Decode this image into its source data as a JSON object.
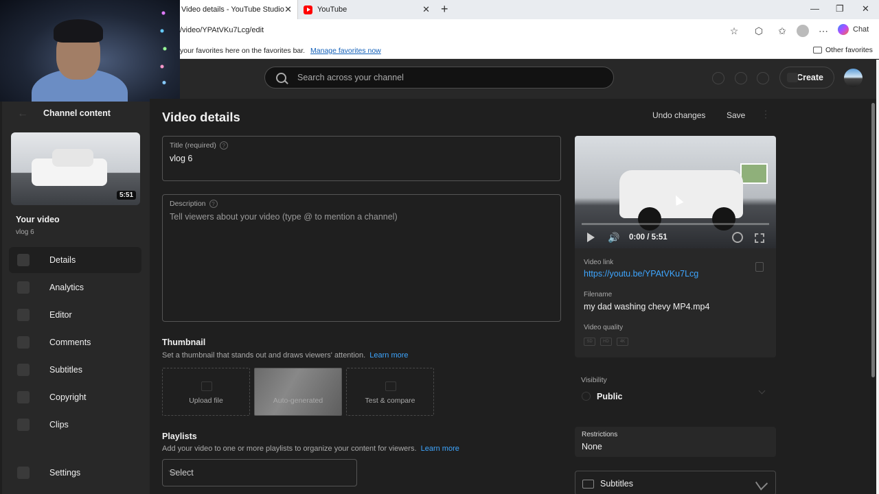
{
  "browser": {
    "tabs": [
      {
        "title": "Video details - YouTube Studio",
        "close": "✕"
      },
      {
        "title": "YouTube",
        "close": "✕"
      }
    ],
    "new_tab": "+",
    "url": "/video/YPAtVKu7Lcg/edit",
    "chat_label": "Chat",
    "favbar_text": "your favorites here on the favorites bar.",
    "favbar_link": "Manage favorites now",
    "other_favorites": "Other favorites"
  },
  "studio_header": {
    "search_placeholder": "Search across your channel",
    "create_label": "Create"
  },
  "sidebar": {
    "section_title": "Channel content",
    "thumb_duration": "5:51",
    "your_video_label": "Your video",
    "video_name": "vlog 6",
    "items": [
      {
        "label": "Details"
      },
      {
        "label": "Analytics"
      },
      {
        "label": "Editor"
      },
      {
        "label": "Comments"
      },
      {
        "label": "Subtitles"
      },
      {
        "label": "Copyright"
      },
      {
        "label": "Clips"
      },
      {
        "label": "Settings"
      }
    ]
  },
  "main": {
    "title": "Video details",
    "undo_label": "Undo changes",
    "save_label": "Save",
    "title_field": {
      "label": "Title (required)",
      "value": "vlog 6"
    },
    "description_field": {
      "label": "Description",
      "placeholder": "Tell viewers about your video (type @ to mention a channel)"
    },
    "thumbnail": {
      "heading": "Thumbnail",
      "desc": "Set a thumbnail that stands out and draws viewers' attention.",
      "learn_more": "Learn more",
      "options": [
        "Upload file",
        "Auto-generated",
        "Test & compare"
      ]
    },
    "playlists": {
      "heading": "Playlists",
      "desc": "Add your video to one or more playlists to organize your content for viewers.",
      "learn_more": "Learn more",
      "select_value": "Select"
    }
  },
  "right": {
    "player_time": "0:00 / 5:51",
    "video_link_label": "Video link",
    "video_link": "https://youtu.be/YPAtVKu7Lcg",
    "filename_label": "Filename",
    "filename": "my dad washing chevy MP4.mp4",
    "quality_label": "Video quality",
    "quality_badges": [
      "SD",
      "HD",
      "4K"
    ],
    "visibility_label": "Visibility",
    "visibility_value": "Public",
    "restrictions_label": "Restrictions",
    "restrictions_value": "None",
    "subtitles_label": "Subtitles"
  }
}
